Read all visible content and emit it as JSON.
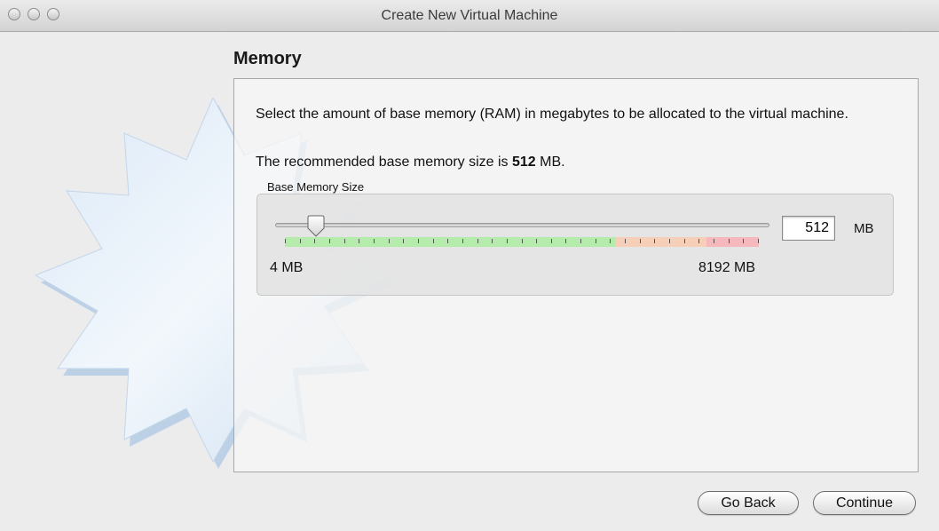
{
  "window": {
    "title": "Create New Virtual Machine"
  },
  "page": {
    "heading": "Memory",
    "description": "Select the amount of base memory (RAM) in megabytes to be allocated to the virtual machine.",
    "recommended_prefix": "The recommended base memory size is ",
    "recommended_value": "512",
    "recommended_suffix": " MB."
  },
  "memory": {
    "group_label": "Base Memory Size",
    "value": "512",
    "unit": "MB",
    "min_label": "4 MB",
    "max_label": "8192 MB",
    "slider_min_mb": 4,
    "slider_max_mb": 8192,
    "slider_value_mb": 512,
    "zone_colors": {
      "safe": "#b6ecab",
      "warn": "#f6cfb8",
      "danger": "#f6b8bd"
    }
  },
  "buttons": {
    "back": "Go Back",
    "continue": "Continue"
  }
}
